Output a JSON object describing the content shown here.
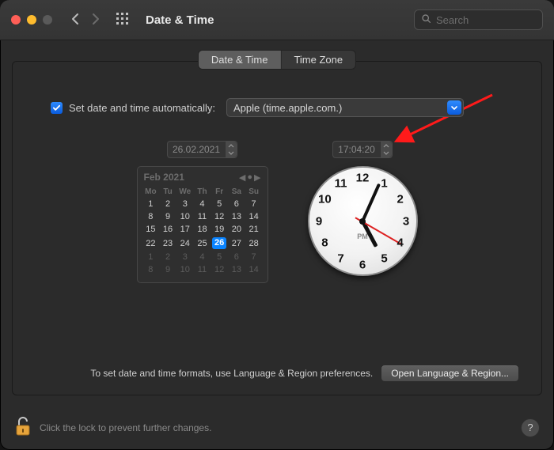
{
  "window": {
    "title": "Date & Time"
  },
  "search": {
    "placeholder": "Search"
  },
  "tabs": {
    "date_time": "Date & Time",
    "time_zone": "Time Zone",
    "selected": 0
  },
  "auto": {
    "checked": true,
    "label": "Set date and time automatically:",
    "server": "Apple (time.apple.com.)"
  },
  "date_field": {
    "text": "26.02.2021"
  },
  "time_field": {
    "text": "17:04:20"
  },
  "calendar": {
    "month_label": "Feb 2021",
    "dow": [
      "Mo",
      "Tu",
      "We",
      "Th",
      "Fr",
      "Sa",
      "Su"
    ],
    "weeks": [
      [
        {
          "d": "1"
        },
        {
          "d": "2"
        },
        {
          "d": "3"
        },
        {
          "d": "4"
        },
        {
          "d": "5"
        },
        {
          "d": "6"
        },
        {
          "d": "7"
        }
      ],
      [
        {
          "d": "8"
        },
        {
          "d": "9"
        },
        {
          "d": "10"
        },
        {
          "d": "11"
        },
        {
          "d": "12"
        },
        {
          "d": "13"
        },
        {
          "d": "14"
        }
      ],
      [
        {
          "d": "15"
        },
        {
          "d": "16"
        },
        {
          "d": "17"
        },
        {
          "d": "18"
        },
        {
          "d": "19"
        },
        {
          "d": "20"
        },
        {
          "d": "21"
        }
      ],
      [
        {
          "d": "22"
        },
        {
          "d": "23"
        },
        {
          "d": "24"
        },
        {
          "d": "25"
        },
        {
          "d": "26",
          "today": true
        },
        {
          "d": "27"
        },
        {
          "d": "28"
        }
      ],
      [
        {
          "d": "1",
          "dim": true
        },
        {
          "d": "2",
          "dim": true
        },
        {
          "d": "3",
          "dim": true
        },
        {
          "d": "4",
          "dim": true
        },
        {
          "d": "5",
          "dim": true
        },
        {
          "d": "6",
          "dim": true
        },
        {
          "d": "7",
          "dim": true
        }
      ],
      [
        {
          "d": "8",
          "dim": true
        },
        {
          "d": "9",
          "dim": true
        },
        {
          "d": "10",
          "dim": true
        },
        {
          "d": "11",
          "dim": true
        },
        {
          "d": "12",
          "dim": true
        },
        {
          "d": "13",
          "dim": true
        },
        {
          "d": "14",
          "dim": true
        }
      ]
    ]
  },
  "clock": {
    "numbers": [
      "12",
      "1",
      "2",
      "3",
      "4",
      "5",
      "6",
      "7",
      "8",
      "9",
      "10",
      "11"
    ],
    "ampm": "PM",
    "hour_angle": 152,
    "minute_angle": 24,
    "second_angle": 120
  },
  "formats_note": "To set date and time formats, use Language & Region preferences.",
  "open_lr_button": "Open Language & Region...",
  "lock_text": "Click the lock to prevent further changes.",
  "help_label": "?"
}
